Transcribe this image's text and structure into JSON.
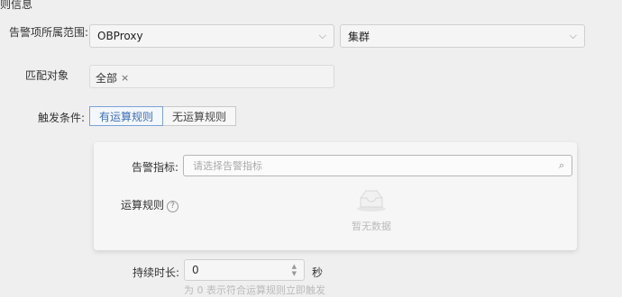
{
  "section": {
    "title": "则信息"
  },
  "alarm_scope": {
    "label": "告警项所属范围:",
    "product_value": "OBProxy",
    "type_value": "集群"
  },
  "match_object": {
    "label": "匹配对象",
    "tag": "全部",
    "tag_remove": "×"
  },
  "trigger": {
    "label": "触发条件:",
    "options": [
      "有运算规则",
      "无运算规则"
    ],
    "active_index": 0
  },
  "metric": {
    "label": "告警指标:",
    "placeholder": "请选择告警指标",
    "search_icon": "search-icon"
  },
  "calc_rule": {
    "label": "运算规则",
    "help": "?",
    "empty_text": "暂无数据"
  },
  "duration": {
    "label": "持续时长:",
    "value": "0",
    "unit": "秒",
    "hint": "为 0 表示符合运算规则立即触发"
  },
  "colors": {
    "accent": "#3d6fb6",
    "border": "#d0d0d0"
  }
}
